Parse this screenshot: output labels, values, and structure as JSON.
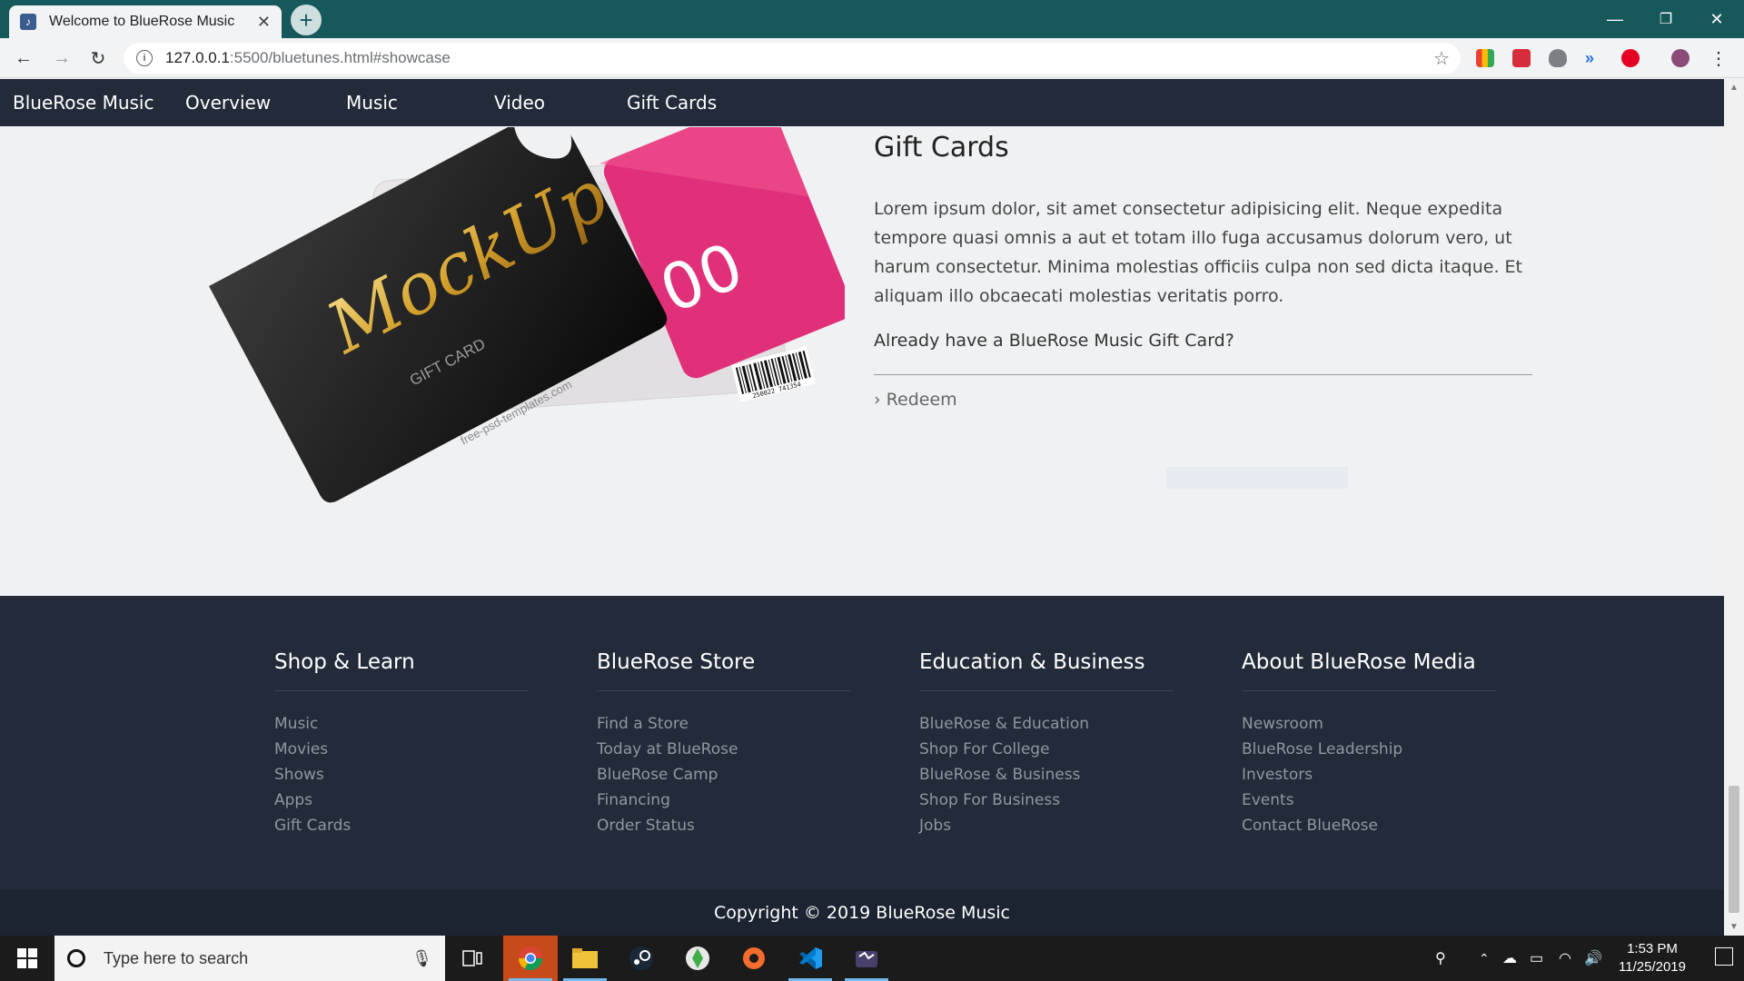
{
  "browser": {
    "tab_title": "Welcome to BlueRose Music",
    "tab_close": "✕",
    "new_tab": "+",
    "url_host": "127.0.0.1",
    "url_rest": ":5500/bluetunes.html#showcase",
    "minimize": "—",
    "restore": "❐",
    "close": "✕"
  },
  "nav": {
    "brand": "BlueRose Music",
    "items": [
      "Overview",
      "Music",
      "Video",
      "Gift Cards"
    ]
  },
  "gift": {
    "title": "Gift Cards",
    "description": "Lorem ipsum dolor, sit amet consectetur adipisicing elit. Neque expedita tempore quasi omnis a aut et totam illo fuga accusamus dolorum vero, ut harum consectetur. Minima molestias officiis culpa non sed dicta itaque. Et aliquam illo obcaecati molestias veritatis porro.",
    "already": "Already have a BlueRose Music Gift Card?",
    "redeem": "Redeem",
    "card_brand": "MockUp",
    "card_sub": "GIFT CARD",
    "card_site": "free-psd-templates.com",
    "card_value": "00",
    "barcode_number": "250022 741354"
  },
  "footer": {
    "columns": [
      {
        "title": "Shop & Learn",
        "links": [
          "Music",
          "Movies",
          "Shows",
          "Apps",
          "Gift Cards"
        ]
      },
      {
        "title": "BlueRose Store",
        "links": [
          "Find a Store",
          "Today at BlueRose",
          "BlueRose Camp",
          "Financing",
          "Order Status"
        ]
      },
      {
        "title": "Education & Business",
        "links": [
          "BlueRose & Education",
          "Shop For College",
          "BlueRose & Business",
          "Shop For Business",
          "Jobs"
        ]
      },
      {
        "title": "About BlueRose Media",
        "links": [
          "Newsroom",
          "BlueRose Leadership",
          "Investors",
          "Events",
          "Contact BlueRose"
        ]
      }
    ],
    "copyright": "Copyright © 2019 BlueRose Music"
  },
  "taskbar": {
    "search_placeholder": "Type here to search",
    "time": "1:53 PM",
    "date": "11/25/2019"
  },
  "colors": {
    "nav_bg": "#232b3b",
    "titlebar": "#17585c",
    "card_pink": "#e0307a"
  }
}
